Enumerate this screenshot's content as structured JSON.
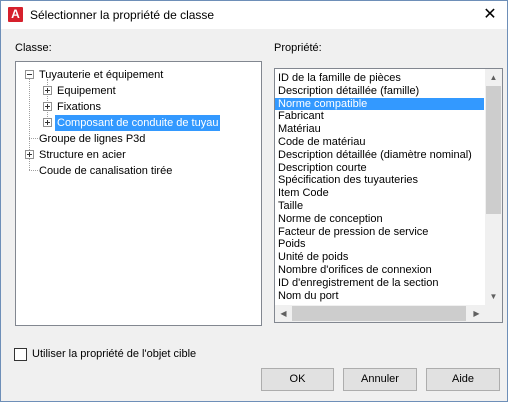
{
  "dialog": {
    "title": "Sélectionner la propriété de classe",
    "close_glyph": "✕"
  },
  "class_panel": {
    "label": "Classe:",
    "tree": [
      {
        "label": "Tuyauterie et équipement",
        "level": 0,
        "expanded": true
      },
      {
        "label": "Equipement",
        "level": 1,
        "expanded": false
      },
      {
        "label": "Fixations",
        "level": 1,
        "expanded": false
      },
      {
        "label": "Composant de conduite de tuyau",
        "level": 1,
        "expanded": false,
        "selected": true
      },
      {
        "label": "Groupe de lignes P3d",
        "level": 0
      },
      {
        "label": "Structure en acier",
        "level": 0,
        "expanded": false
      },
      {
        "label": "Coude de canalisation tirée",
        "level": 0
      }
    ]
  },
  "property_panel": {
    "label": "Propriété:",
    "selected_index": 2,
    "items": [
      "ID de la famille de pièces",
      "Description détaillée (famille)",
      "Norme compatible",
      "Fabricant",
      "Matériau",
      "Code de matériau",
      "Description détaillée (diamètre nominal)",
      "Description courte",
      "Spécification des tuyauteries",
      "Item Code",
      "Taille",
      "Norme de conception",
      "Facteur de pression de service",
      "Poids",
      "Unité de poids",
      "Nombre d'orifices de connexion",
      "ID d'enregistrement de la section",
      "Nom du port"
    ]
  },
  "options": {
    "use_target_label": "Utiliser la propriété de l'objet cible",
    "use_target_checked": false
  },
  "buttons": {
    "ok": "OK",
    "cancel": "Annuler",
    "help": "Aide"
  },
  "colors": {
    "selection": "#3399ff",
    "app_icon": "#d6202c"
  },
  "icons": {
    "app": "autocad-a-icon",
    "close": "close-icon",
    "scroll_up": "triangle-up-icon",
    "scroll_down": "triangle-down-icon",
    "scroll_left": "triangle-left-icon",
    "scroll_right": "triangle-right-icon"
  }
}
